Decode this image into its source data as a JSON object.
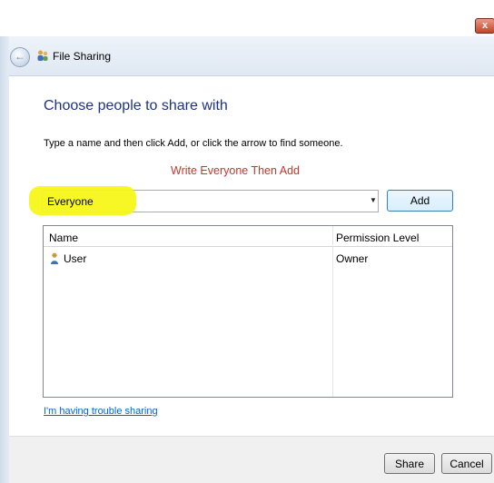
{
  "window": {
    "title": "File Sharing",
    "close_label": "x"
  },
  "nav": {
    "back_glyph": "←",
    "title_icon": "people-icon"
  },
  "content": {
    "heading": "Choose people to share with",
    "instruction": "Type a name and then click Add, or click the arrow to find someone.",
    "annotation": "Write Everyone Then Add",
    "input_value": "Everyone",
    "dropdown_glyph": "▼",
    "add_label": "Add"
  },
  "list": {
    "columns": [
      "Name",
      "Permission Level"
    ],
    "rows": [
      {
        "name": "User",
        "permission": "Owner"
      }
    ]
  },
  "help_link": "I'm having trouble sharing",
  "footer": {
    "share_label": "Share",
    "cancel_label": "Cancel"
  },
  "colors": {
    "heading": "#1e3287",
    "annotation": "#c0392b",
    "highlight": "#f7f71a",
    "link": "#0066cc"
  }
}
